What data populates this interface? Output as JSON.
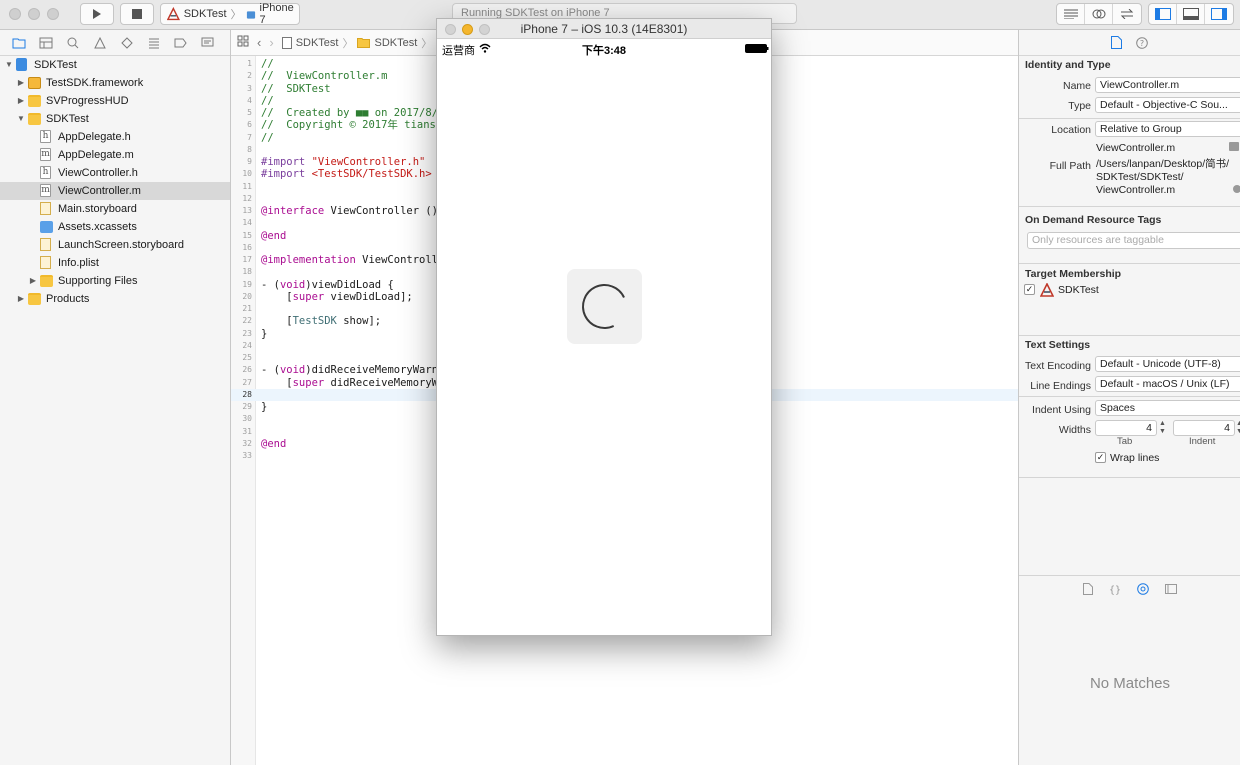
{
  "toolbar": {
    "scheme_target": "SDKTest",
    "scheme_device": "iPhone 7",
    "activity_status": "Running SDKTest on iPhone 7"
  },
  "navigator": {
    "tree": [
      {
        "label": "SDKTest",
        "icon": "project-icon",
        "level": 0,
        "disclosure": "▼"
      },
      {
        "label": "TestSDK.framework",
        "icon": "framework-icon",
        "level": 1,
        "disclosure": "▶"
      },
      {
        "label": "SVProgressHUD",
        "icon": "folder-icon",
        "level": 1,
        "disclosure": "▶"
      },
      {
        "label": "SDKTest",
        "icon": "folder-icon",
        "level": 1,
        "disclosure": "▼"
      },
      {
        "label": "AppDelegate.h",
        "icon": "header-file-icon",
        "glyph": "h",
        "level": 2
      },
      {
        "label": "AppDelegate.m",
        "icon": "implementation-file-icon",
        "glyph": "m",
        "level": 2
      },
      {
        "label": "ViewController.h",
        "icon": "header-file-icon",
        "glyph": "h",
        "level": 2
      },
      {
        "label": "ViewController.m",
        "icon": "implementation-file-icon",
        "glyph": "m",
        "level": 2,
        "selected": true
      },
      {
        "label": "Main.storyboard",
        "icon": "storyboard-icon",
        "level": 2
      },
      {
        "label": "Assets.xcassets",
        "icon": "assets-icon",
        "level": 2
      },
      {
        "label": "LaunchScreen.storyboard",
        "icon": "storyboard-icon",
        "level": 2
      },
      {
        "label": "Info.plist",
        "icon": "plist-icon",
        "level": 2
      },
      {
        "label": "Supporting Files",
        "icon": "folder-icon",
        "level": 2,
        "disclosure": "▶"
      },
      {
        "label": "Products",
        "icon": "folder-icon",
        "level": 1,
        "disclosure": "▶"
      }
    ]
  },
  "editor": {
    "breadcrumb": [
      "SDKTest",
      "SDKTest"
    ],
    "current_line": 28,
    "lines": [
      {
        "n": 1,
        "segs": [
          {
            "t": "//",
            "c": "c-comment"
          }
        ]
      },
      {
        "n": 2,
        "segs": [
          {
            "t": "//  ViewController.m",
            "c": "c-comment"
          }
        ]
      },
      {
        "n": 3,
        "segs": [
          {
            "t": "//  SDKTest",
            "c": "c-comment"
          }
        ]
      },
      {
        "n": 4,
        "segs": [
          {
            "t": "//",
            "c": "c-comment"
          }
        ]
      },
      {
        "n": 5,
        "segs": [
          {
            "t": "//  Created by ",
            "c": "c-comment"
          },
          {
            "t": "■■",
            "c": "c-comment"
          },
          {
            "t": " on 2017/8/",
            "c": "c-comment"
          }
        ]
      },
      {
        "n": 6,
        "segs": [
          {
            "t": "//  Copyright © 2017年 tiansh",
            "c": "c-comment"
          }
        ]
      },
      {
        "n": 7,
        "segs": [
          {
            "t": "//",
            "c": "c-comment"
          }
        ]
      },
      {
        "n": 8,
        "segs": []
      },
      {
        "n": 9,
        "segs": [
          {
            "t": "#import ",
            "c": "c-directive"
          },
          {
            "t": "\"ViewController.h\"",
            "c": "c-string"
          }
        ]
      },
      {
        "n": 10,
        "segs": [
          {
            "t": "#import ",
            "c": "c-directive"
          },
          {
            "t": "<TestSDK/TestSDK.h>",
            "c": "c-string"
          }
        ]
      },
      {
        "n": 11,
        "segs": []
      },
      {
        "n": 12,
        "segs": []
      },
      {
        "n": 13,
        "segs": [
          {
            "t": "@interface",
            "c": "c-keyword"
          },
          {
            "t": " ViewController ()",
            "c": ""
          }
        ]
      },
      {
        "n": 14,
        "segs": []
      },
      {
        "n": 15,
        "segs": [
          {
            "t": "@end",
            "c": "c-keyword"
          }
        ]
      },
      {
        "n": 16,
        "segs": []
      },
      {
        "n": 17,
        "segs": [
          {
            "t": "@implementation",
            "c": "c-keyword"
          },
          {
            "t": " ViewControlle",
            "c": ""
          }
        ]
      },
      {
        "n": 18,
        "segs": []
      },
      {
        "n": 19,
        "segs": [
          {
            "t": "- (",
            "c": ""
          },
          {
            "t": "void",
            "c": "c-keyword"
          },
          {
            "t": ")viewDidLoad {",
            "c": ""
          }
        ]
      },
      {
        "n": 20,
        "segs": [
          {
            "t": "    [",
            "c": ""
          },
          {
            "t": "super",
            "c": "c-keyword"
          },
          {
            "t": " viewDidLoad];",
            "c": ""
          }
        ]
      },
      {
        "n": 21,
        "segs": []
      },
      {
        "n": 22,
        "segs": [
          {
            "t": "    [",
            "c": ""
          },
          {
            "t": "TestSDK",
            "c": "c-class"
          },
          {
            "t": " show];",
            "c": ""
          }
        ]
      },
      {
        "n": 23,
        "segs": [
          {
            "t": "}",
            "c": ""
          }
        ]
      },
      {
        "n": 24,
        "segs": []
      },
      {
        "n": 25,
        "segs": []
      },
      {
        "n": 26,
        "segs": [
          {
            "t": "- (",
            "c": ""
          },
          {
            "t": "void",
            "c": "c-keyword"
          },
          {
            "t": ")didReceiveMemoryWarni",
            "c": ""
          }
        ]
      },
      {
        "n": 27,
        "segs": [
          {
            "t": "    [",
            "c": ""
          },
          {
            "t": "super",
            "c": "c-keyword"
          },
          {
            "t": " didReceiveMemoryWa",
            "c": ""
          }
        ]
      },
      {
        "n": 28,
        "segs": []
      },
      {
        "n": 29,
        "segs": [
          {
            "t": "}",
            "c": ""
          }
        ]
      },
      {
        "n": 30,
        "segs": []
      },
      {
        "n": 31,
        "segs": []
      },
      {
        "n": 32,
        "segs": [
          {
            "t": "@end",
            "c": "c-keyword"
          }
        ]
      },
      {
        "n": 33,
        "segs": []
      }
    ]
  },
  "simulator": {
    "title": "iPhone 7 – iOS 10.3 (14E8301)",
    "carrier": "运营商",
    "time": "下午3:48"
  },
  "inspector": {
    "identity": {
      "title": "Identity and Type",
      "name_label": "Name",
      "name_value": "ViewController.m",
      "type_label": "Type",
      "type_value": "Default - Objective-C Sou...",
      "location_label": "Location",
      "location_value": "Relative to Group",
      "location_file": "ViewController.m",
      "fullpath_label": "Full Path",
      "fullpath_lines": [
        "/Users/lanpan/Desktop/简书/",
        "SDKTest/SDKTest/",
        "ViewController.m"
      ]
    },
    "on_demand": {
      "title": "On Demand Resource Tags",
      "placeholder": "Only resources are taggable"
    },
    "target": {
      "title": "Target Membership",
      "name": "SDKTest",
      "checked": true
    },
    "text_settings": {
      "title": "Text Settings",
      "encoding_label": "Text Encoding",
      "encoding_value": "Default - Unicode (UTF-8)",
      "endings_label": "Line Endings",
      "endings_value": "Default - macOS / Unix (LF)",
      "indent_using_label": "Indent Using",
      "indent_using_value": "Spaces",
      "widths_label": "Widths",
      "tab_value": "4",
      "indent_value": "4",
      "tab_caption": "Tab",
      "indent_caption": "Indent",
      "wrap_label": "Wrap lines",
      "wrap_checked": true
    },
    "library": {
      "empty_text": "No Matches"
    }
  }
}
